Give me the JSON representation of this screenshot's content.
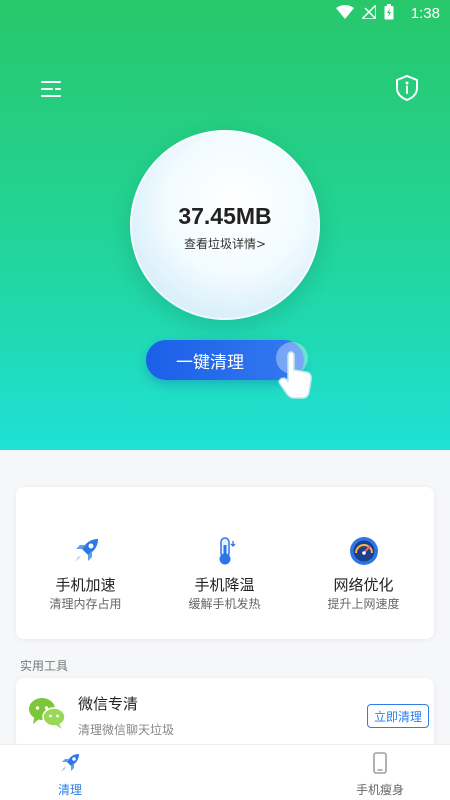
{
  "status_bar": {
    "time": "1:38",
    "icons": [
      "wifi-icon",
      "signal-icon",
      "battery-icon"
    ]
  },
  "header": {
    "menu_icon": "menu-icon",
    "shield_icon": "shield-info-icon"
  },
  "junk": {
    "size": "37.45MB",
    "details_link": "查看垃圾详情>"
  },
  "clean_button": {
    "label": "一键清理"
  },
  "tools": [
    {
      "icon": "rocket-icon",
      "name": "手机加速",
      "desc": "清理内存占用"
    },
    {
      "icon": "thermometer-icon",
      "name": "手机降温",
      "desc": "缓解手机发热"
    },
    {
      "icon": "speedometer-icon",
      "name": "网络优化",
      "desc": "提升上网速度"
    }
  ],
  "section": {
    "utilities_label": "实用工具"
  },
  "wechat": {
    "title": "微信专清",
    "desc": "清理微信聊天垃圾",
    "button": "立即清理"
  },
  "nav": [
    {
      "icon": "rocket-icon",
      "label": "清理",
      "active": true
    },
    {
      "icon": "phone-icon",
      "label": "手机瘦身",
      "active": false
    }
  ],
  "colors": {
    "accent": "#2e7de9",
    "hero_top": "#28c76a",
    "hero_bottom": "#1fe0d6"
  }
}
